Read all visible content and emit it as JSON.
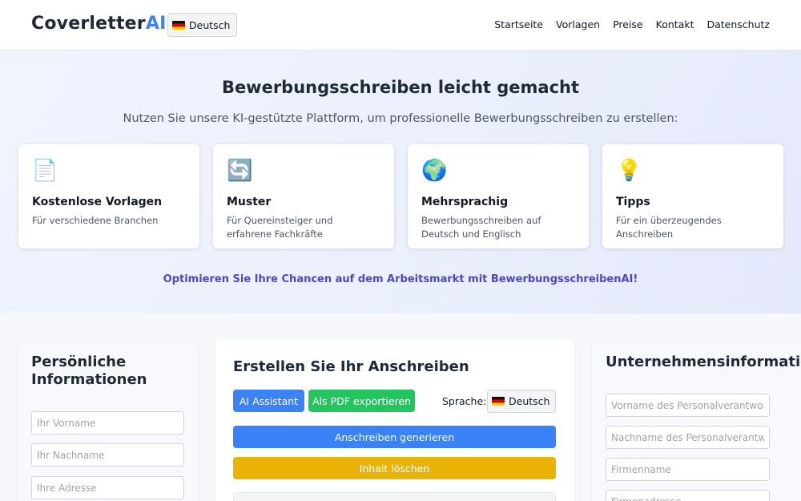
{
  "header": {
    "logo_main": "Coverletter",
    "logo_accent": "AI",
    "language": "Deutsch",
    "nav": [
      "Startseite",
      "Vorlagen",
      "Preise",
      "Kontakt",
      "Datenschutz"
    ]
  },
  "hero": {
    "title": "Bewerbungsschreiben leicht gemacht",
    "subtitle": "Nutzen Sie unsere KI-gestützte Plattform, um professionelle Bewerbungsschreiben zu erstellen:",
    "cards": [
      {
        "icon": "📄",
        "icon_name": "document-icon",
        "title": "Kostenlose Vorlagen",
        "text": "Für verschiedene Branchen"
      },
      {
        "icon": "🔄",
        "icon_name": "refresh-icon",
        "title": "Muster",
        "text": "Für Quereinsteiger und erfahrene Fachkräfte"
      },
      {
        "icon": "🌍",
        "icon_name": "globe-icon",
        "title": "Mehrsprachig",
        "text": "Bewerbungsschreiben auf Deutsch und Englisch"
      },
      {
        "icon": "💡",
        "icon_name": "lightbulb-icon",
        "title": "Tipps",
        "text": "Für ein überzeugendes Anschreiben"
      }
    ],
    "cta": "Optimieren Sie Ihre Chancen auf dem Arbeitsmarkt mit BewerbungsschreibenAI!"
  },
  "personal": {
    "title": "Persönliche Informationen",
    "fields": [
      {
        "placeholder": "Ihr Vorname"
      },
      {
        "placeholder": "Ihr Nachname"
      },
      {
        "placeholder": "Ihre Adresse"
      }
    ]
  },
  "editor": {
    "title": "Erstellen Sie Ihr Anschreiben",
    "ai_button": "AI Assistant",
    "pdf_button": "Als PDF exportieren",
    "language_label": "Sprache:",
    "language_value": "Deutsch",
    "generate_button": "Anschreiben generieren",
    "clear_button": "Inhalt löschen"
  },
  "company": {
    "title": "Unternehmensinformationen",
    "fields": [
      {
        "placeholder": "Vorname des Personalverantwortlichen"
      },
      {
        "placeholder": "Nachname des Personalverantwortlichen"
      },
      {
        "placeholder": "Firmenname"
      },
      {
        "placeholder": "Firmenadresse"
      }
    ]
  },
  "colors": {
    "accent": "#3b82f6",
    "success": "#22c55e",
    "warning": "#eab308",
    "cta": "#4f46c5"
  }
}
